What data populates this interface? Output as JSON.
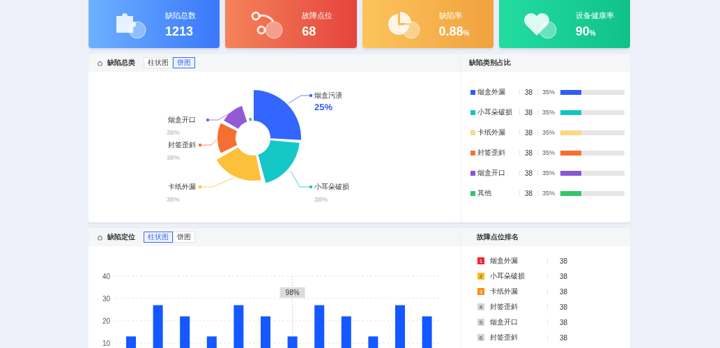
{
  "stat_cards": [
    {
      "kind": "defects",
      "title": "缺陷总数",
      "value": "1213"
    },
    {
      "kind": "points",
      "title": "故障点位",
      "value": "68"
    },
    {
      "kind": "rate",
      "title": "缺陷率",
      "value": "0.88",
      "unit": "%"
    },
    {
      "kind": "health",
      "title": "设备健康率",
      "value": "90",
      "unit": "%"
    }
  ],
  "defect_category_panel": {
    "title": "缺陷总类",
    "view_tabs": [
      {
        "label": "柱状图",
        "selected": false
      },
      {
        "label": "饼图",
        "selected": true
      }
    ],
    "pie_segments": [
      {
        "name": "烟盒污渍",
        "percent": "25%",
        "color": "#3366ff",
        "selected": true
      },
      {
        "name": "烟盒开口",
        "percent": "38%",
        "color": "#915bd6",
        "selected": false
      },
      {
        "name": "封签歪斜",
        "percent": "38%",
        "color": "#f66f32",
        "selected": false
      },
      {
        "name": "卡纸外漏",
        "percent": "38%",
        "color": "#fdc03a",
        "selected": false
      },
      {
        "name": "小耳朵破损",
        "percent": "38%",
        "color": "#14c8c8",
        "selected": false
      },
      {
        "color": "#3cc46e"
      }
    ]
  },
  "category_share": {
    "title": "缺陷类别占比",
    "rows": [
      {
        "name": "烟盒外漏",
        "count": "38",
        "percent": "35%",
        "level": 0.33,
        "color": "#2f5ef5"
      },
      {
        "name": "小耳朵破损",
        "count": "38",
        "percent": "35%",
        "level": 0.33,
        "color": "#14c4c4"
      },
      {
        "name": "卡纸外漏",
        "count": "38",
        "percent": "35%",
        "level": 0.33,
        "color": "#fdd784"
      },
      {
        "name": "封签歪斜",
        "count": "38",
        "percent": "35%",
        "level": 0.33,
        "color": "#f66f32"
      },
      {
        "name": "烟盒开口",
        "count": "38",
        "percent": "35%",
        "level": 0.33,
        "color": "#8b55d6"
      },
      {
        "name": "其他",
        "count": "38",
        "percent": "35%",
        "level": 0.33,
        "color": "#34c46a"
      }
    ]
  },
  "defect_location_panel": {
    "title": "缺陷定位",
    "view_tabs": [
      {
        "label": "柱状图",
        "selected": true
      },
      {
        "label": "饼图",
        "selected": false
      }
    ],
    "chart_data": {
      "type": "bar",
      "series": [
        {
          "color": "#1458ff",
          "values": [
            13,
            27,
            22,
            13,
            27,
            22,
            13,
            27,
            22,
            13,
            27,
            22
          ]
        }
      ],
      "ylim": [
        0,
        40
      ],
      "yticks": [
        10,
        20,
        30,
        40
      ],
      "grid": true,
      "annotations": [
        {
          "text": "98%"
        }
      ]
    }
  },
  "fault_ranking": {
    "title": "故障点位排名",
    "rows": [
      {
        "rank": "1",
        "name": "烟盒外漏",
        "count": "38",
        "color": "#f5222d"
      },
      {
        "rank": "2",
        "name": "小耳朵破损",
        "count": "38",
        "color": "#fbbf24"
      },
      {
        "rank": "3",
        "name": "卡纸外漏",
        "count": "38",
        "color": "#fa8c16"
      },
      {
        "rank": "4",
        "name": "封签歪斜",
        "count": "38",
        "color": "#d4d4d4"
      },
      {
        "rank": "5",
        "name": "烟盒开口",
        "count": "38",
        "color": "#d4d4d4"
      },
      {
        "rank": "6",
        "name": "封签歪斜",
        "count": "38",
        "color": "#d4d4d4"
      }
    ]
  }
}
